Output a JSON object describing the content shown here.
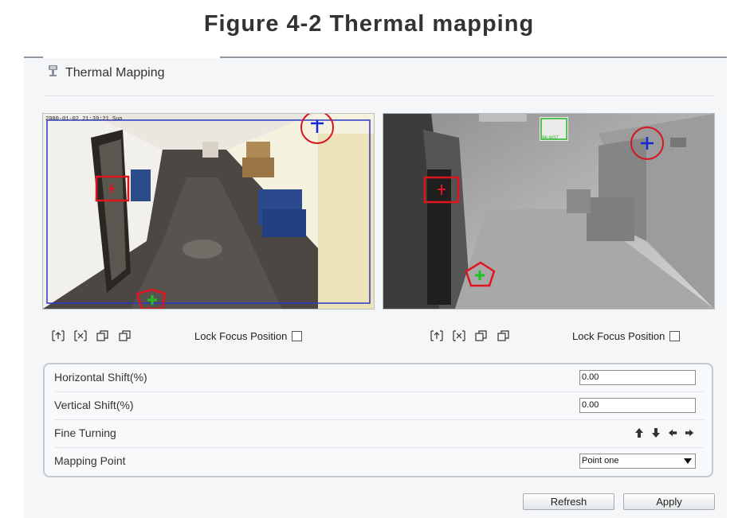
{
  "figure_title": "Figure 4-2  Thermal mapping",
  "header": {
    "title": "Thermal Mapping",
    "icon": "thermal-mapping-icon"
  },
  "left_video": {
    "timestamp": "2000-01-02 21:39:21 Sun",
    "lock_focus_label": "Lock Focus Position",
    "lock_focus_checked": false
  },
  "right_video": {
    "sign_text": "96 W37",
    "lock_focus_label": "Lock Focus Position",
    "lock_focus_checked": false
  },
  "controls_icons": [
    "zoom-in-icon",
    "zoom-out-icon",
    "copy-icon",
    "paste-icon"
  ],
  "settings": {
    "horizontal_shift_label": "Horizontal Shift(%)",
    "horizontal_shift_value": "0.00",
    "vertical_shift_label": "Vertical Shift(%)",
    "vertical_shift_value": "0.00",
    "fine_turning_label": "Fine Turning",
    "mapping_point_label": "Mapping Point",
    "mapping_point_value": "Point one"
  },
  "buttons": {
    "refresh": "Refresh",
    "apply": "Apply"
  },
  "colors": {
    "marker_red": "#e0141e",
    "marker_blue": "#1428d8",
    "marker_green": "#20c020",
    "rule": "#8d9aa5"
  }
}
